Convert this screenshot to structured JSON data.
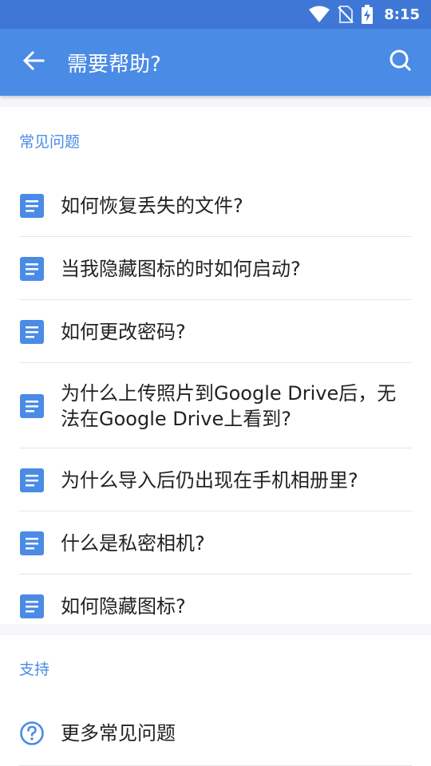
{
  "status_bar": {
    "time": "8:15",
    "icons": [
      "wifi-icon",
      "no-sim-icon",
      "battery-charging-icon"
    ]
  },
  "app_bar": {
    "title": "需要帮助?",
    "back_icon": "arrow-left-icon",
    "search_icon": "search-icon"
  },
  "faq": {
    "header": "常见问题",
    "item_icon": "document-icon",
    "items": [
      "如何恢复丢失的文件?",
      "当我隐藏图标的时如何启动?",
      "如何更改密码?",
      "为什么上传照片到Google Drive后，无法在Google Drive上看到?",
      "为什么导入后仍出现在手机相册里?",
      "什么是私密相机?",
      "如何隐藏图标?"
    ]
  },
  "support": {
    "header": "支持",
    "item_icon": "question-circle-icon",
    "items": [
      "更多常见问题"
    ]
  },
  "colors": {
    "status_bar": "#3f77d6",
    "app_bar": "#4a8be6",
    "accent": "#4a8be6",
    "icon": "#4a8be6"
  }
}
